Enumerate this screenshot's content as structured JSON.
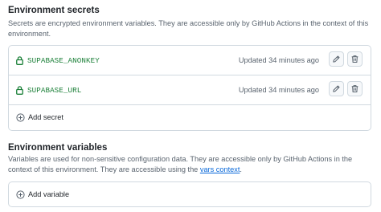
{
  "secrets_section": {
    "title": "Environment secrets",
    "description": "Secrets are encrypted environment variables. They are accessible only by GitHub Actions in the context of this environment.",
    "items": [
      {
        "name": "SUPABASE_ANONKEY",
        "updated": "Updated 34 minutes ago"
      },
      {
        "name": "SUPABASE_URL",
        "updated": "Updated 34 minutes ago"
      }
    ],
    "add_label": "Add secret"
  },
  "variables_section": {
    "title": "Environment variables",
    "description_before": "Variables are used for non-sensitive configuration data. They are accessible only by GitHub Actions in the context of this environment. They are accessible using the ",
    "link_text": "vars context",
    "description_after": ".",
    "add_label": "Add variable"
  },
  "colors": {
    "secret_name": "#1a7f37",
    "link": "#0969da",
    "border": "#d1d9e0",
    "muted_text": "#59636e"
  },
  "icons": {
    "lock": "lock-icon",
    "edit": "pencil-icon",
    "delete": "trash-icon",
    "add": "plus-circle-icon"
  }
}
